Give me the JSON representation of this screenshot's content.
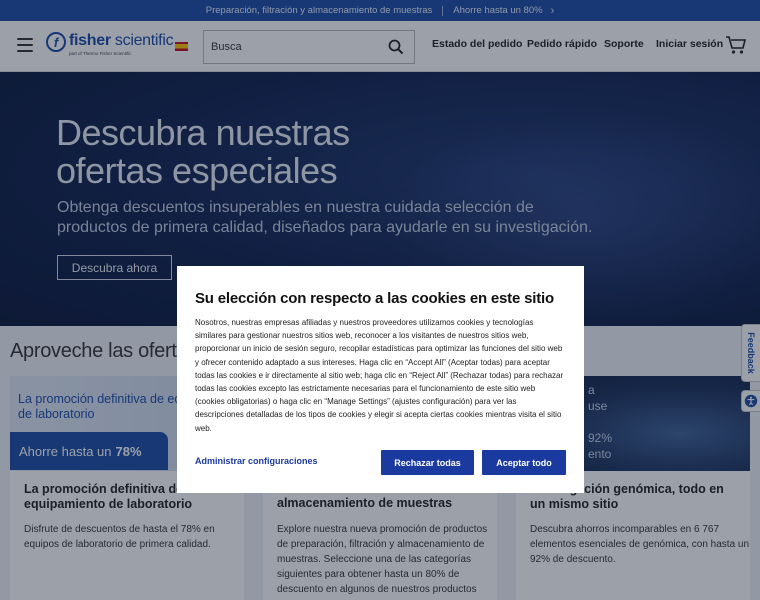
{
  "promo": {
    "text": "Preparación, filtración y almacenamiento de muestras",
    "offer": "Ahorre hasta un 80%"
  },
  "header": {
    "logo_name_bold": "fisher",
    "logo_name_rest": " scientific",
    "logo_sub": "part of Thermo Fisher Scientific",
    "search_placeholder": "Busca",
    "nav": [
      "Estado del pedido",
      "Pedido rápido",
      "Soporte",
      "Iniciar sesión"
    ]
  },
  "hero": {
    "title_line1": "Descubra nuestras",
    "title_line2": "ofertas especiales",
    "description": "Obtenga descuentos insuperables en nuestra cuidada selección de productos de primera calidad, diseñados para ayudarle en su investigación.",
    "button": "Descubra ahora"
  },
  "offers": {
    "title": "Aproveche las ofertas",
    "cards": [
      {
        "img_text": "La promoción definitiva de equipamiento de laboratorio",
        "badge_prefix": "Ahorre hasta un",
        "badge_value": "78%",
        "title": "La promoción definitiva de equipamiento de laboratorio",
        "text": "Disfrute de descuentos de hasta el 78% en equipos de laboratorio de primera calidad."
      },
      {
        "title": "almacenamiento de muestras",
        "text": "Explore nuestra nueva promoción de productos de preparación, filtración y almacenamiento de muestras. Seleccione una de las categorías siguientes para obtener hasta un 80% de descuento en algunos de nuestros productos"
      },
      {
        "img_text_1": "a",
        "img_text_2": "use",
        "img_text_3": "92%",
        "img_text_4": "ento",
        "title": "investigación genómica, todo en un mismo sitio",
        "text": "Descubra ahorros incomparables en 6 767 elementos esenciales de genómica, con hasta un 92% de descuento."
      }
    ]
  },
  "side": {
    "feedback": "Feedback"
  },
  "cookie_modal": {
    "title": "Su elección con respecto a las cookies en este sitio",
    "body": "Nosotros, nuestras empresas afiliadas y nuestros proveedores utilizamos cookies y tecnologías similares para gestionar nuestros sitios web, reconocer a los visitantes de nuestros sitios web, proporcionar un inicio de sesión seguro, recopilar estadísticas para optimizar las funciones del sitio web y ofrecer contenido adaptado a sus intereses. Haga clic en “Accept All” (Aceptar todas) para aceptar todas las cookies e ir directamente al sitio web; haga clic en “Reject All” (Rechazar todas) para rechazar todas las cookies excepto las estrictamente necesarias para el funcionamiento de este sitio web (cookies obligatorias) o haga clic en “Manage Settings” (ajustes configuración) para ver las descripciones detalladas de los tipos de cookies y elegir si acepta ciertas cookies mientras visita el sitio web.",
    "manage": "Administrar configuraciones",
    "reject": "Rechazar todas",
    "accept": "Aceptar todo"
  },
  "colors": {
    "brand": "#1b4aa6",
    "button": "#1b3aa0"
  }
}
